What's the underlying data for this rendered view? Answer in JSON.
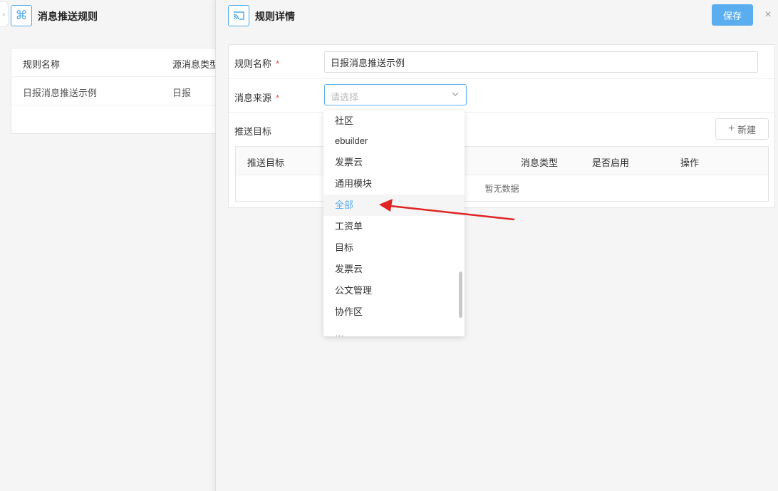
{
  "left": {
    "collapse_glyph": "‹",
    "title": "消息推送规则",
    "columns": [
      "规则名称",
      "源消息类型"
    ],
    "rows": [
      [
        "日报消息推送示例",
        "日报"
      ]
    ]
  },
  "right": {
    "title": "规则详情",
    "save_label": "保存",
    "close_glyph": "×",
    "form": {
      "name_label": "规则名称",
      "name_value": "日报消息推送示例",
      "source_label": "消息来源",
      "source_placeholder": "请选择",
      "required_mark": "*",
      "target_label": "推送目标",
      "new_label": "新建"
    },
    "target_table": {
      "columns": [
        "推送目标",
        "消息类型",
        "是否启用",
        "操作"
      ],
      "empty_text": "暂无数据"
    }
  },
  "dropdown": {
    "options": [
      "社区",
      "ebuilder",
      "发票云",
      "通用模块",
      "全部",
      "工资单",
      "目标",
      "发票云",
      "公文管理",
      "协作区",
      "…"
    ],
    "highlighted": "全部"
  },
  "colors": {
    "accent": "#5aaef0",
    "required": "#e6533c",
    "annotation_arrow": "#e02424"
  },
  "icons": {
    "left_app": "command-icon",
    "right_panel": "cast-icon",
    "select": "chevron-down-icon"
  }
}
